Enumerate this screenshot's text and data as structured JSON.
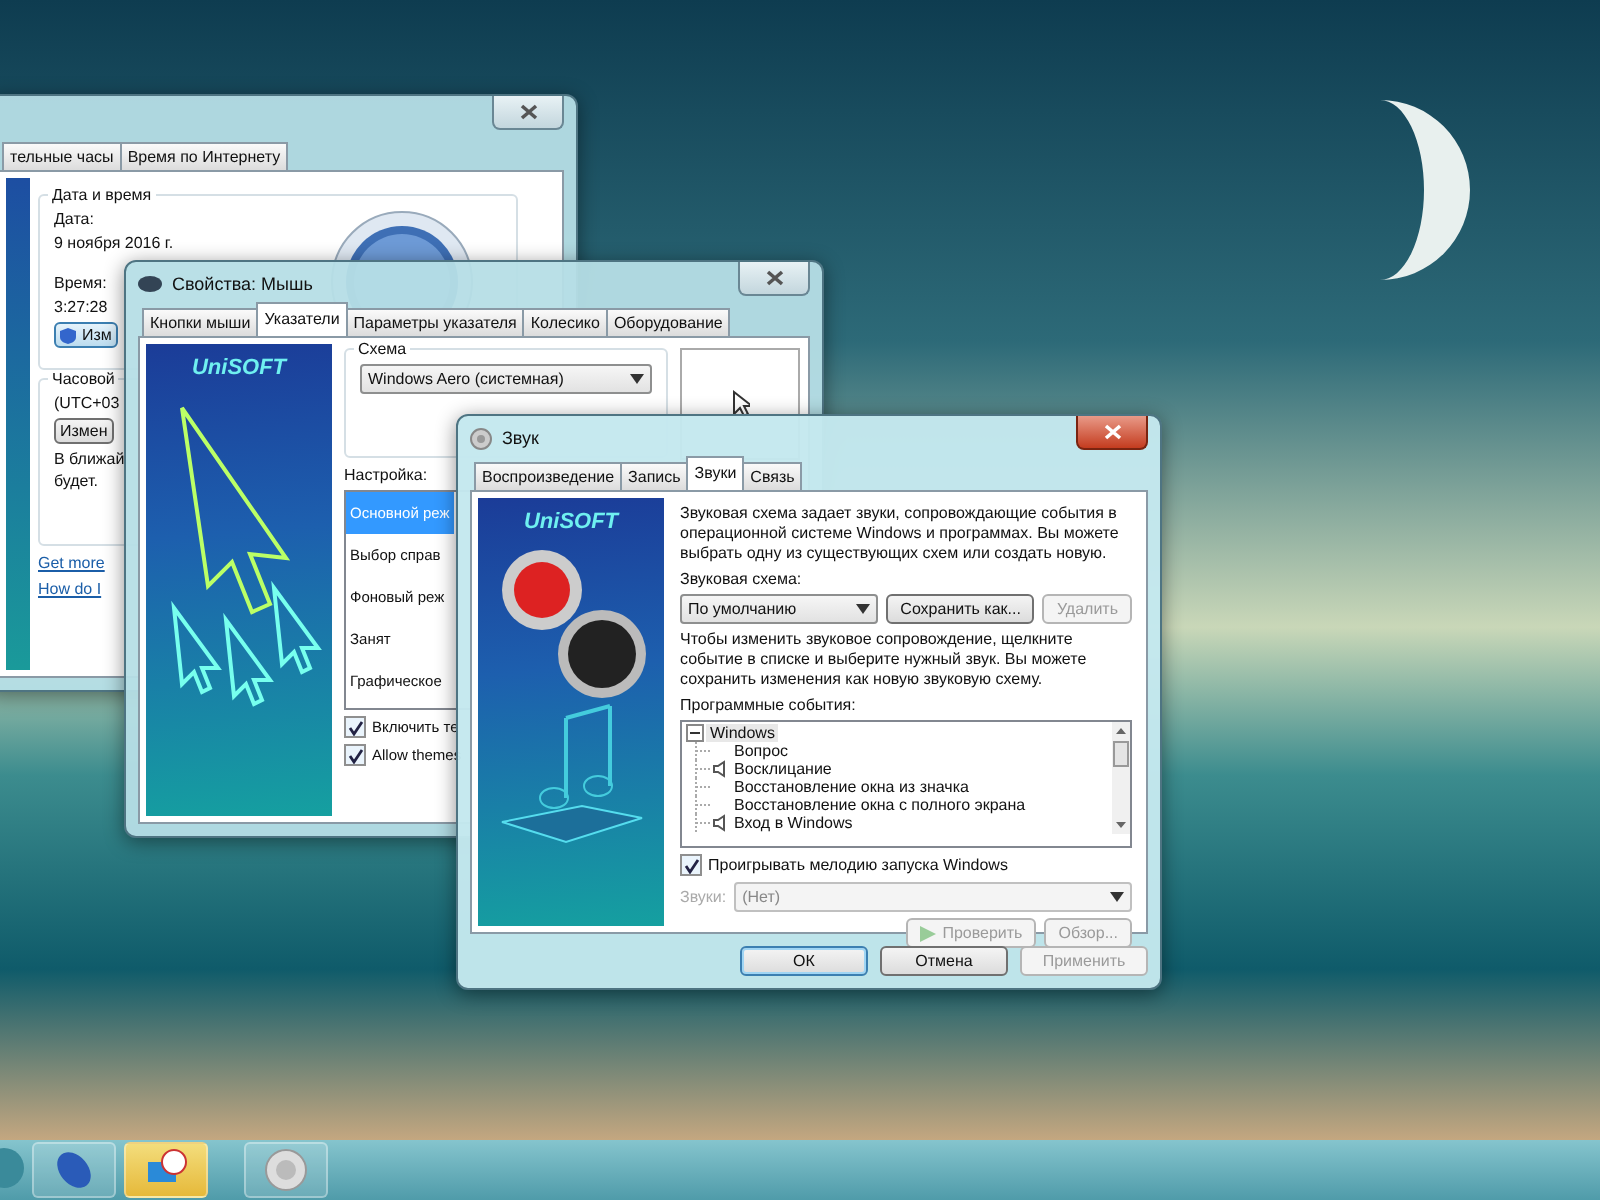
{
  "datetime_window": {
    "tabs": [
      {
        "label": "тельные часы",
        "selected": false
      },
      {
        "label": "Время по Интернету",
        "selected": false
      }
    ],
    "date_group": {
      "title": "Дата и время",
      "date_label": "Дата:",
      "date": "9 ноября 2016 г.",
      "time_label": "Время:",
      "time": "3:27:28",
      "change_button": "Изм"
    },
    "timezone_group": {
      "title": "Часовой",
      "zone": "(UTC+03",
      "change_button": "Измен",
      "note": [
        "В ближай",
        "будет."
      ]
    },
    "links": [
      "Get more",
      "How do I"
    ]
  },
  "mouse_window": {
    "title": "Свойства: Мышь",
    "tabs": [
      {
        "label": "Кнопки мыши",
        "selected": false
      },
      {
        "label": "Указатели",
        "selected": true
      },
      {
        "label": "Параметры указателя",
        "selected": false
      },
      {
        "label": "Колесико",
        "selected": false
      },
      {
        "label": "Оборудование",
        "selected": false
      }
    ],
    "banner_logo": "UniSOFT",
    "scheme_title": "Схема",
    "scheme_value": "Windows Aero (системная)",
    "customize_label": "Настройка:",
    "cursors": [
      {
        "label": "Основной реж",
        "selected": true
      },
      {
        "label": "Выбор справ",
        "selected": false
      },
      {
        "label": "Фоновый реж",
        "selected": false
      },
      {
        "label": "Занят",
        "selected": false
      },
      {
        "label": "Графическое",
        "selected": false
      }
    ],
    "checkboxes": [
      {
        "label": "Включить те",
        "checked": true
      },
      {
        "label": "Allow themes",
        "checked": true
      }
    ]
  },
  "sound_window": {
    "title": "Звук",
    "tabs": [
      {
        "label": "Воспроизведение",
        "selected": false
      },
      {
        "label": "Запись",
        "selected": false
      },
      {
        "label": "Звуки",
        "selected": true
      },
      {
        "label": "Связь",
        "selected": false
      }
    ],
    "banner_logo": "UniSOFT",
    "intro": "Звуковая схема задает звуки, сопровождающие события в операционной системе Windows и программах. Вы можете выбрать одну из существующих схем или создать новую.",
    "scheme_label": "Звуковая схема:",
    "scheme_value": "По умолчанию",
    "scheme_buttons": [
      {
        "label": "Сохранить как...",
        "disabled": false
      },
      {
        "label": "Удалить",
        "disabled": true
      }
    ],
    "hint": "Чтобы изменить звуковое сопровождение, щелкните событие в списке и выберите нужный звук. Вы можете сохранить изменения как новую звуковую схему.",
    "events_label": "Программные события:",
    "events": [
      {
        "label": "Windows",
        "children": [
          {
            "label": "Вопрос",
            "has_sound": false
          },
          {
            "label": "Восклицание",
            "has_sound": true
          },
          {
            "label": "Восстановление окна из значка",
            "has_sound": false
          },
          {
            "label": "Восстановление окна с полного экрана",
            "has_sound": false
          },
          {
            "label": "Вход в Windows",
            "has_sound": true
          }
        ]
      }
    ],
    "startup_checkbox": {
      "label": "Проигрывать мелодию запуска Windows",
      "checked": true
    },
    "sounds_field": {
      "label": "Звуки:",
      "value": "(Нет)",
      "disabled": true
    },
    "sound_buttons": [
      {
        "kind": "play",
        "label": "Проверить",
        "disabled": true
      },
      {
        "kind": "plain",
        "label": "Обзор...",
        "disabled": true
      }
    ],
    "footer_buttons": [
      {
        "label": "ОК",
        "disabled": false,
        "default": true
      },
      {
        "label": "Отмена",
        "disabled": false,
        "default": false
      },
      {
        "label": "Применить",
        "disabled": true,
        "default": false
      }
    ]
  },
  "taskbar": {
    "items": [
      {
        "kind": "start",
        "selected": false
      },
      {
        "kind": "mouse",
        "selected": false
      },
      {
        "kind": "clock",
        "selected": true
      },
      {
        "kind": "speaker",
        "selected": false
      }
    ]
  }
}
